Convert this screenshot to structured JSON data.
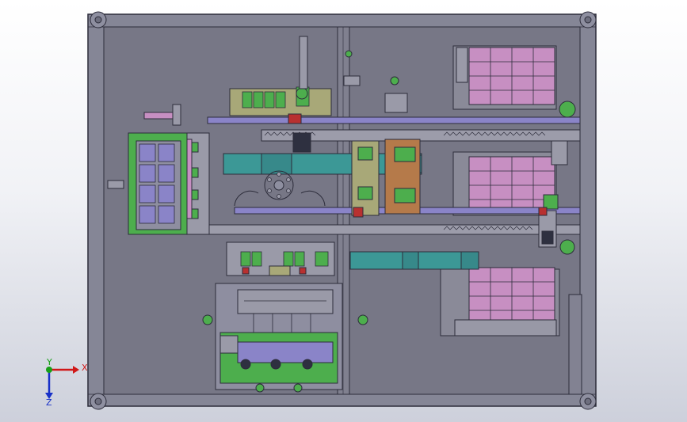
{
  "viewport": {
    "background_top": "#ffffff",
    "background_bottom": "#cdd0db"
  },
  "colors": {
    "frame": "#858696",
    "plate": "#777786",
    "line": "#2c2c3a",
    "magenta": "#c78fc2",
    "green": "#4dae4d",
    "teal": "#3c9896",
    "orange": "#b57a4a",
    "purple_rail": "#8a84c8",
    "red": "#b83030",
    "olive": "#a8a878"
  },
  "triad": {
    "x_label": "X",
    "y_label": "Y",
    "z_label": "Z",
    "x_color": "#d01818",
    "y_color": "#18a018",
    "z_color": "#1830c8"
  }
}
